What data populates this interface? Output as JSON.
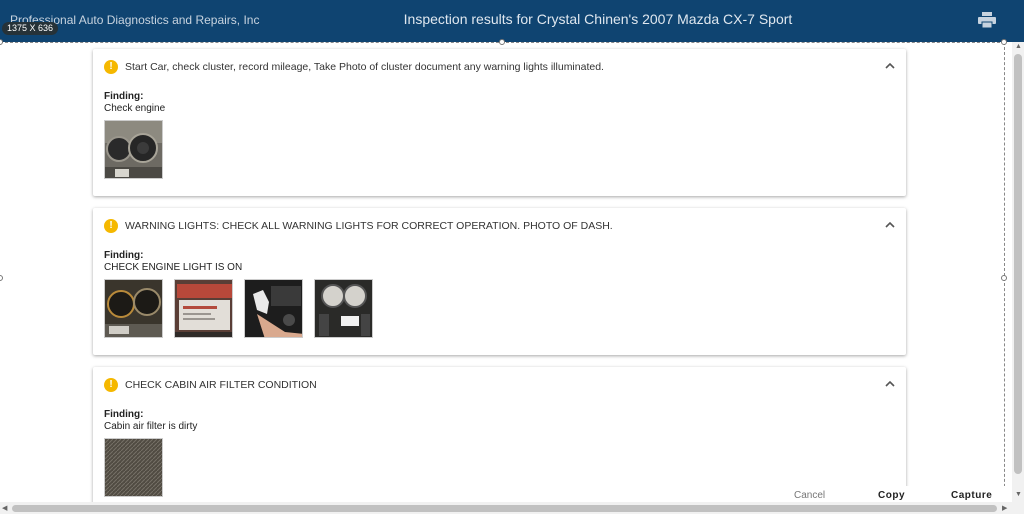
{
  "header": {
    "brand": "Professional Auto Diagnostics and Repairs, Inc",
    "title": "Inspection results for Crystal Chinen's 2007 Mazda CX-7 Sport",
    "print_icon": "print-icon",
    "dimension_badge": "1375 X 636"
  },
  "cards": [
    {
      "title": "Start Car, check cluster, record mileage, Take Photo of cluster document any warning lights illuminated.",
      "finding_label": "Finding:",
      "finding": "Check engine",
      "photo_count": 1
    },
    {
      "title": "WARNING LIGHTS: CHECK ALL WARNING LIGHTS FOR CORRECT OPERATION. PHOTO OF DASH.",
      "finding_label": "Finding:",
      "finding": "CHECK ENGINE LIGHT IS ON",
      "photo_count": 4
    },
    {
      "title": "CHECK CABIN AIR FILTER CONDITION",
      "finding_label": "Finding:",
      "finding": "Cabin air filter is dirty",
      "photo_count": 1
    }
  ],
  "actions": {
    "cancel": "Cancel",
    "copy": "Copy",
    "capture": "Capture"
  },
  "colors": {
    "header_bg": "#0f4471",
    "warning": "#f5b800"
  }
}
